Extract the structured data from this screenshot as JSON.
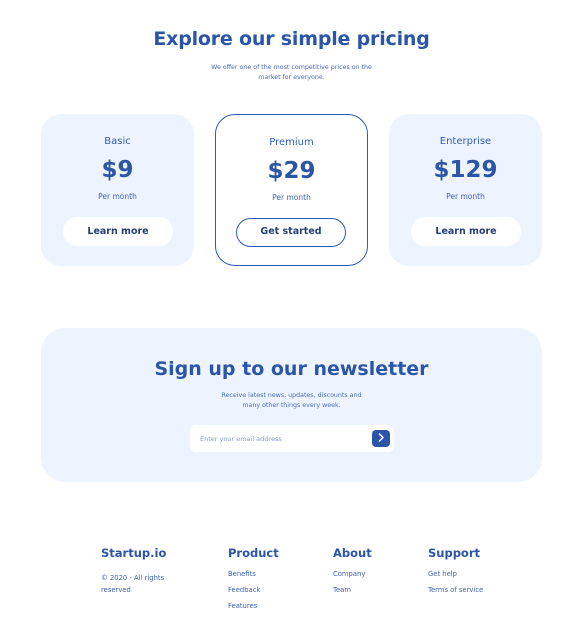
{
  "pricing": {
    "title": "Explore our simple pricing",
    "subtitle": "We offer one of the most competitive prices on the market for everyone.",
    "plans": [
      {
        "name": "Basic",
        "price": "$9",
        "period": "Per month",
        "cta": "Learn more"
      },
      {
        "name": "Premium",
        "price": "$29",
        "period": "Per month",
        "cta": "Get started"
      },
      {
        "name": "Enterprise",
        "price": "$129",
        "period": "Per month",
        "cta": "Learn more"
      }
    ]
  },
  "newsletter": {
    "title": "Sign up to our newsletter",
    "subtitle": "Receive latest news, updates, discounts and many other things every week.",
    "email_placeholder": "Enter your email address",
    "submit_icon": "chevron-right-icon"
  },
  "footer": {
    "brand": "Startup.io",
    "copyright": "© 2020 - All rights reserved",
    "columns": [
      {
        "title": "Product",
        "links": [
          "Benefits",
          "Feedback",
          "Features"
        ]
      },
      {
        "title": "About",
        "links": [
          "Company",
          "Team"
        ]
      },
      {
        "title": "Support",
        "links": [
          "Get help",
          "Terms of service"
        ]
      }
    ]
  },
  "colors": {
    "primary": "#2b55a6",
    "card_bg": "#eef4ff",
    "background": "#ffffff"
  }
}
